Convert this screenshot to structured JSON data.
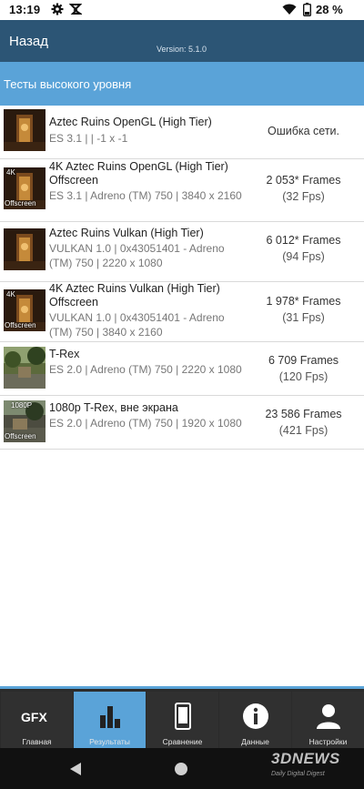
{
  "status_bar": {
    "time": "13:19",
    "battery_percent": "28 %",
    "icons": [
      "gear-icon",
      "gfx-notification-icon",
      "wifi-icon",
      "battery-icon"
    ]
  },
  "header": {
    "back_label": "Назад",
    "version": "Version: 5.1.0"
  },
  "section": {
    "title": "Тесты высокого уровня"
  },
  "tests": [
    {
      "name": "Aztec Ruins OpenGL (High Tier)",
      "details": "ES 3.1 |  | -1 x -1",
      "result": "Ошибка сети.",
      "fps": "",
      "thumb_tag": ""
    },
    {
      "name": "4K Aztec Ruins OpenGL (High Tier) Offscreen",
      "details": "ES 3.1 | Adreno (TM) 750 | 3840 x 2160",
      "result": "2 053* Frames",
      "fps": "(32 Fps)",
      "thumb_tag": "4K",
      "thumb_tag2": "Offscreen"
    },
    {
      "name": "Aztec Ruins Vulkan (High Tier)",
      "details": "VULKAN 1.0 | 0x43051401 - Adreno (TM) 750 | 2220 x 1080",
      "result": "6 012* Frames",
      "fps": "(94 Fps)",
      "thumb_tag": ""
    },
    {
      "name": "4K Aztec Ruins Vulkan (High Tier) Offscreen",
      "details": "VULKAN 1.0 | 0x43051401 - Adreno (TM) 750 | 3840 x 2160",
      "result": "1 978* Frames",
      "fps": "(31 Fps)",
      "thumb_tag": "4K",
      "thumb_tag2": "Offscreen"
    },
    {
      "name": "T-Rex",
      "details": "ES 2.0 | Adreno (TM) 750 | 2220 x 1080",
      "result": "6 709 Frames",
      "fps": "(120 Fps)",
      "thumb_tag": ""
    },
    {
      "name": "1080p T-Rex, вне экрана",
      "details": "ES 2.0 | Adreno (TM) 750 | 1920 x 1080",
      "result": "23 586 Frames",
      "fps": "(421 Fps)",
      "thumb_tag": "1080P",
      "thumb_tag2": "Offscreen"
    }
  ],
  "bottom_nav": {
    "items": [
      {
        "label": "Главная",
        "icon": "gfx-logo-icon",
        "active": false
      },
      {
        "label": "Результаты",
        "icon": "bar-chart-icon",
        "active": true
      },
      {
        "label": "Сравнение",
        "icon": "phone-icon",
        "active": false
      },
      {
        "label": "Данные",
        "icon": "info-icon",
        "active": false
      },
      {
        "label": "Настройки",
        "icon": "user-icon",
        "active": false
      }
    ],
    "gfx_text": "GFX"
  },
  "watermark": {
    "main": "3DNEWS",
    "sub": "Daily Digital Digest"
  },
  "colors": {
    "header": "#2c5575",
    "accent": "#5aa3d8",
    "nav_bg": "#2b2b2b"
  }
}
